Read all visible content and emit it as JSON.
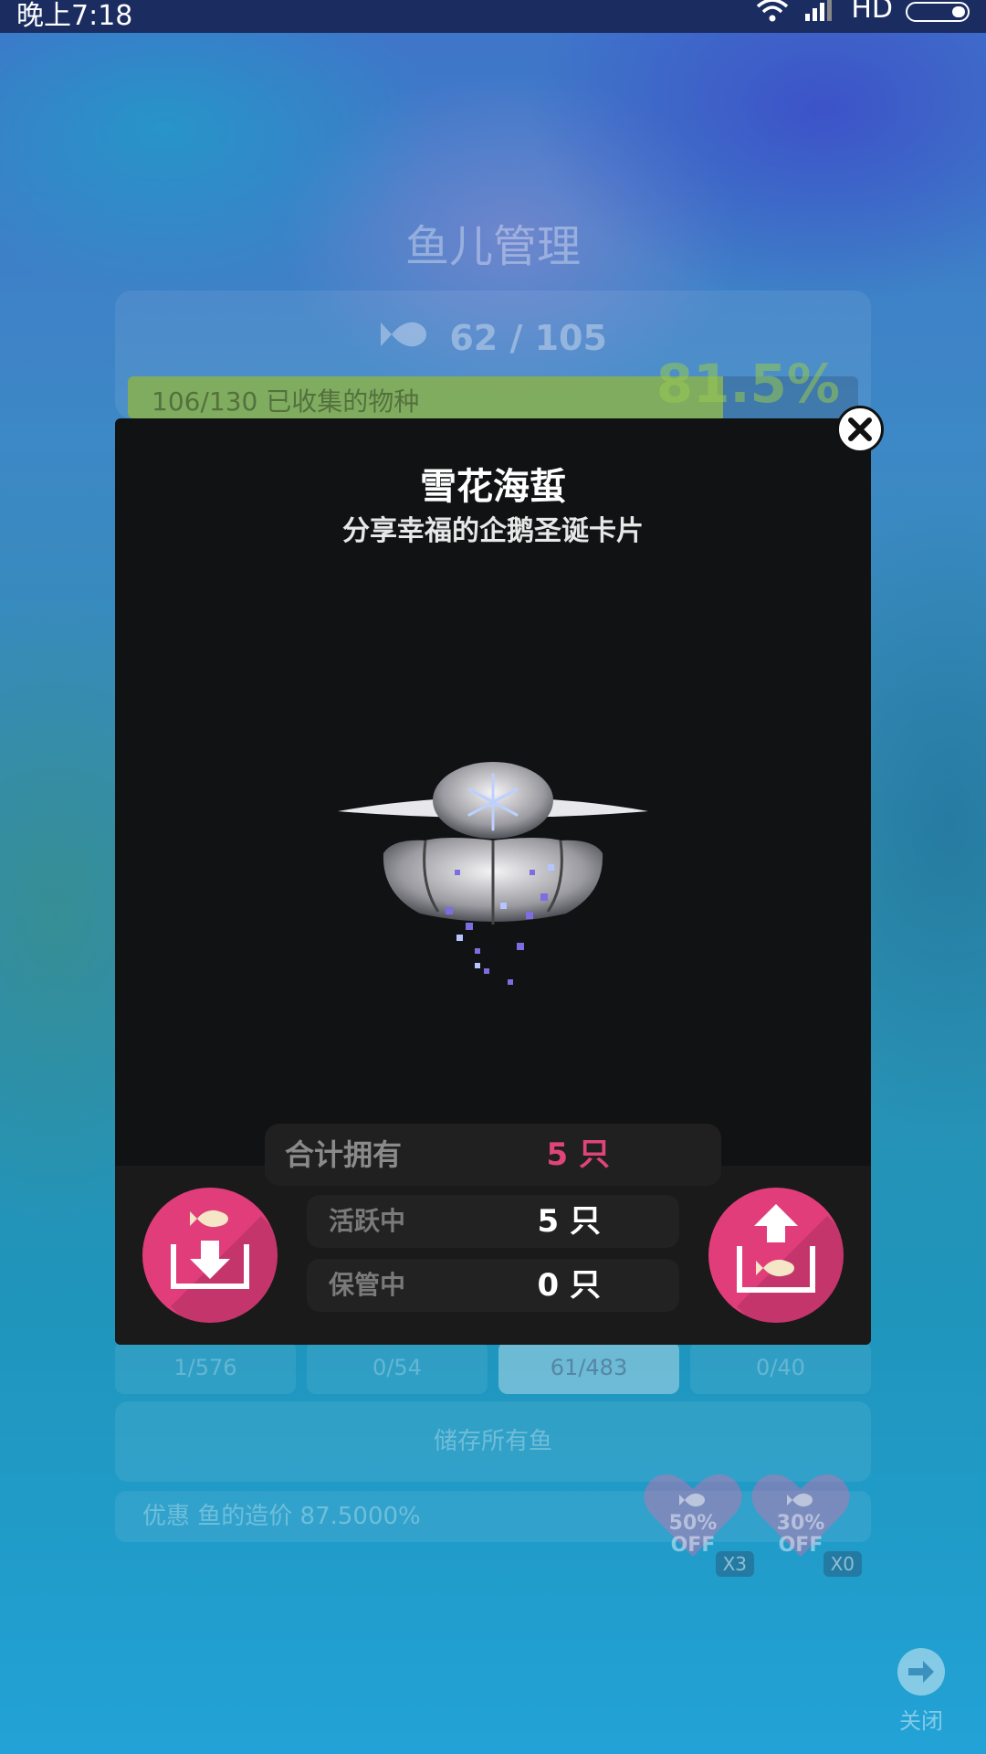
{
  "status_bar": {
    "time": "晚上7:18",
    "network": "HD"
  },
  "background": {
    "title": "鱼儿管理",
    "fish_count": "62 / 105",
    "species_progress_label": "106/130 已收集的物种",
    "species_progress": 0.815,
    "species_percent": "81.5%",
    "tabs": [
      "1/576",
      "0/54",
      "61/483",
      "0/40"
    ],
    "active_tab_index": 2,
    "store_all_label": "储存所有鱼",
    "discount_label": "优惠 鱼的造价 87.5000%",
    "coupons": [
      {
        "percent": "50%",
        "off": "OFF",
        "multiplier": "X3"
      },
      {
        "percent": "30%",
        "off": "OFF",
        "multiplier": "X0"
      }
    ],
    "close_label": "关闭"
  },
  "modal": {
    "title": "雪花海蜇",
    "subtitle": "分享幸福的企鹅圣诞卡片",
    "total_label": "合计拥有",
    "total_value": "5 只",
    "active_label": "活跃中",
    "active_value": "5 只",
    "stored_label": "保管中",
    "stored_value": "0 只"
  },
  "colors": {
    "accent_pink": "#e03d7a",
    "modal_bg": "#111213",
    "progress_green": "#96be46"
  },
  "icons": {
    "close": "close-x-icon",
    "store": "fish-store-icon",
    "release": "fish-release-icon",
    "fish": "fish-icon",
    "arrow_right": "arrow-right-icon"
  }
}
